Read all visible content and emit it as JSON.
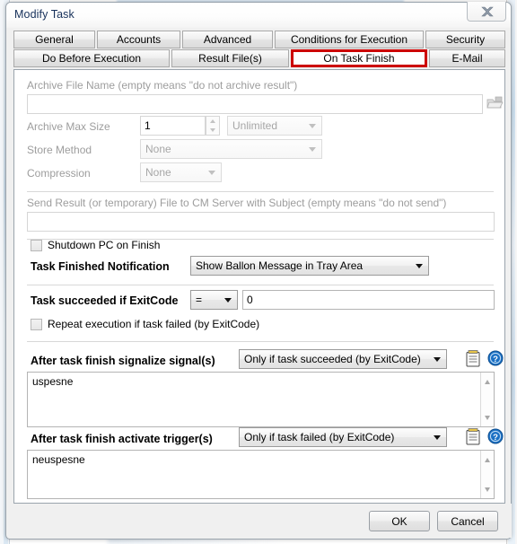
{
  "window": {
    "title": "Modify Task",
    "close_label": "Close"
  },
  "tabs": {
    "row1": [
      {
        "label": "General",
        "selected": false
      },
      {
        "label": "Accounts",
        "selected": false
      },
      {
        "label": "Advanced",
        "selected": false
      },
      {
        "label": "Conditions for Execution",
        "selected": false
      },
      {
        "label": "Security",
        "selected": false
      }
    ],
    "row2": [
      {
        "label": "Do Before Execution",
        "selected": false
      },
      {
        "label": "Result File(s)",
        "selected": false
      },
      {
        "label": "On Task Finish",
        "selected": true
      },
      {
        "label": "E-Mail",
        "selected": false
      }
    ],
    "highlight_color": "#cc0000"
  },
  "form": {
    "archive_file_name_label": "Archive File Name (empty means \"do not archive result\")",
    "archive_file_name_value": "",
    "browse_icon": "open-folder-icon",
    "archive_max_size_label": "Archive Max Size",
    "archive_max_size_value": "1",
    "archive_max_size_unit": "Unlimited",
    "store_method_label": "Store Method",
    "store_method_value": "None",
    "compression_label": "Compression",
    "compression_value": "None",
    "send_result_label": "Send Result (or temporary) File to CM Server with Subject (empty means \"do not send\")",
    "send_result_value": "",
    "shutdown_label": "Shutdown PC on Finish",
    "shutdown_checked": false,
    "notification_label": "Task Finished Notification",
    "notification_value": "Show Ballon Message in Tray Area",
    "exitcode_label": "Task succeeded if ExitCode",
    "exitcode_operator": "=",
    "exitcode_value": "0",
    "repeat_label": "Repeat execution if task failed (by ExitCode)",
    "repeat_checked": false,
    "signal_label": "After task finish signalize signal(s)",
    "signal_condition": "Only if task succeeded (by ExitCode)",
    "signal_text": "uspesne",
    "trigger_label": "After task finish activate trigger(s)",
    "trigger_condition": "Only if task failed (by ExitCode)",
    "trigger_text": "neuspesne",
    "list_icon": "clipboard-icon",
    "help_icon": "help-question-icon"
  },
  "footer": {
    "ok_label": "OK",
    "cancel_label": "Cancel"
  }
}
